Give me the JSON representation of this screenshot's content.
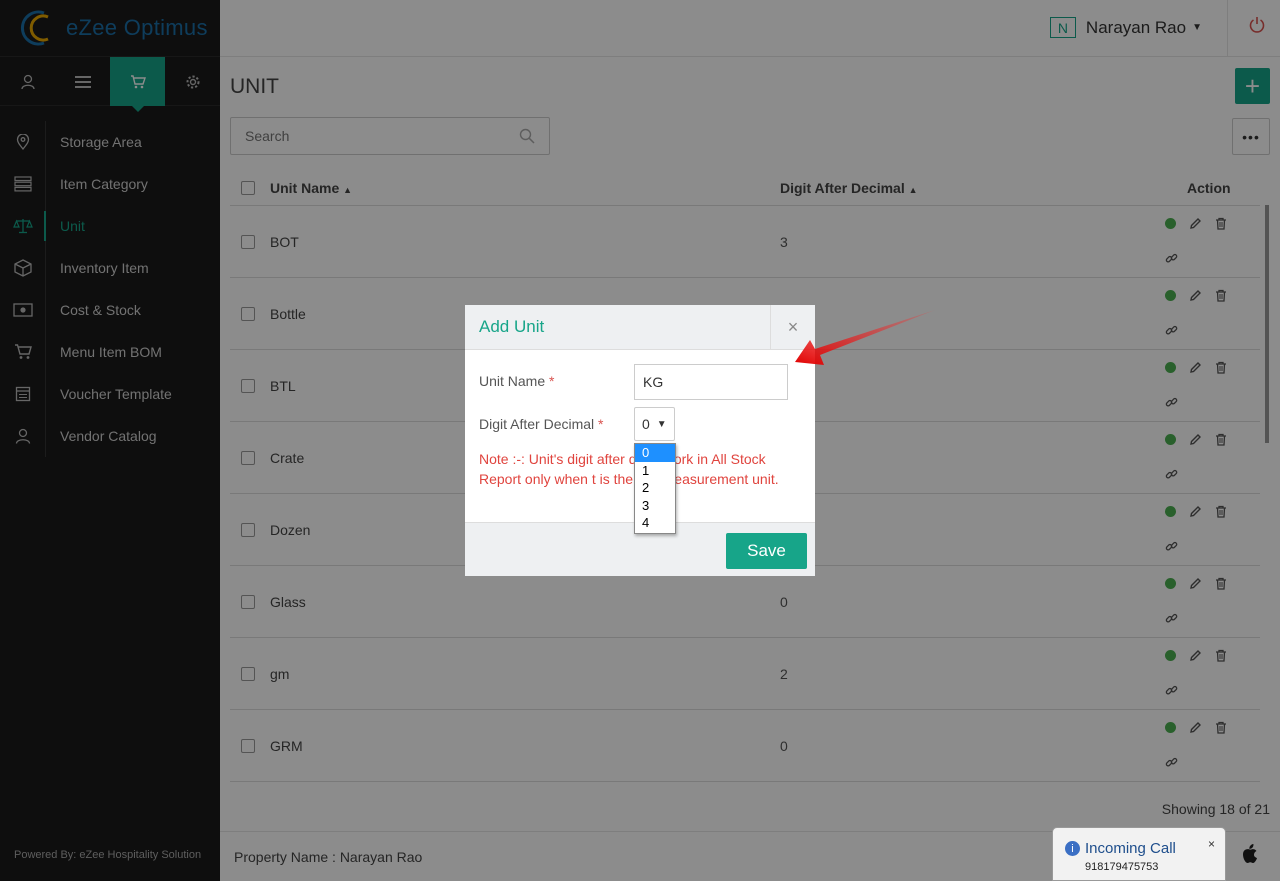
{
  "app": {
    "title": "eZee Optimus",
    "powered_by": "Powered By: eZee Hospitality Solution"
  },
  "sidebar": {
    "tabs": [
      {
        "icon": "user-icon"
      },
      {
        "icon": "menu-icon"
      },
      {
        "icon": "cart-icon",
        "active": true
      },
      {
        "icon": "gear-icon"
      }
    ],
    "items": [
      {
        "label": "Storage Area",
        "icon": "map-pin-icon"
      },
      {
        "label": "Item Category",
        "icon": "list-icon"
      },
      {
        "label": "Unit",
        "icon": "scale-icon",
        "active": true
      },
      {
        "label": "Inventory Item",
        "icon": "box-icon"
      },
      {
        "label": "Cost & Stock",
        "icon": "money-icon"
      },
      {
        "label": "Menu Item BOM",
        "icon": "cart-icon"
      },
      {
        "label": "Voucher Template",
        "icon": "voucher-icon"
      },
      {
        "label": "Vendor Catalog",
        "icon": "vendor-icon"
      }
    ]
  },
  "header": {
    "user_initial": "N",
    "user_name": "Narayan Rao"
  },
  "page": {
    "title": "UNIT",
    "add_label": "+",
    "more_label": "•••",
    "search_placeholder": "Search",
    "showing": "Showing 18 of 21",
    "property": "Property Name : Narayan Rao"
  },
  "table": {
    "columns": {
      "name": "Unit Name",
      "digit": "Digit After Decimal",
      "action": "Action"
    },
    "rows": [
      {
        "name": "BOT",
        "digit": "3"
      },
      {
        "name": "Bottle",
        "digit": ""
      },
      {
        "name": "BTL",
        "digit": ""
      },
      {
        "name": "Crate",
        "digit": ""
      },
      {
        "name": "Dozen",
        "digit": ""
      },
      {
        "name": "Glass",
        "digit": "0"
      },
      {
        "name": "gm",
        "digit": "2"
      },
      {
        "name": "GRM",
        "digit": "0"
      }
    ]
  },
  "modal": {
    "title": "Add Unit",
    "close": "×",
    "unit_name_label": "Unit Name",
    "unit_name_value": "KG",
    "digit_label": "Digit After Decimal",
    "required": "*",
    "digit_value": "0",
    "digit_options": [
      "0",
      "1",
      "2",
      "3",
      "4"
    ],
    "note": "Note :-: Unit's digit after d          will work in All Stock Report only when t          is the last measurement unit.",
    "save_label": "Save"
  },
  "call": {
    "title": "Incoming Call",
    "number": "918179475753",
    "close": "×"
  },
  "colors": {
    "accent": "#17a589",
    "danger": "#d9534f",
    "sidebar": "#1a1a1a"
  }
}
